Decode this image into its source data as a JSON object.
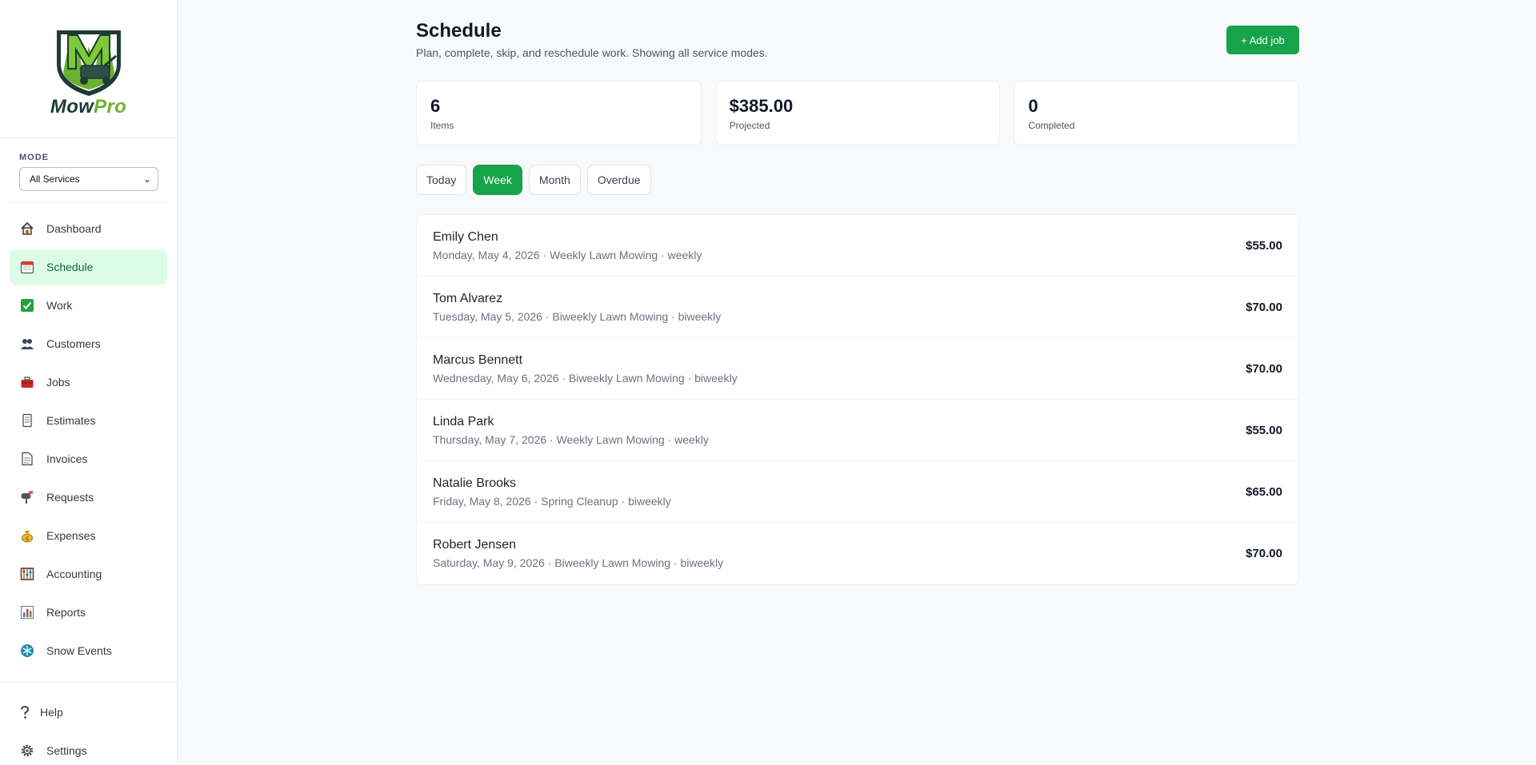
{
  "brand": {
    "name_part1": "Mow",
    "name_part2": "Pro"
  },
  "sidebar": {
    "mode_label": "MODE",
    "mode_value": "All Services",
    "items": [
      {
        "label": "Dashboard",
        "icon": "house-icon"
      },
      {
        "label": "Schedule",
        "icon": "calendar-icon",
        "active": true
      },
      {
        "label": "Work",
        "icon": "check-box-icon"
      },
      {
        "label": "Customers",
        "icon": "people-icon"
      },
      {
        "label": "Jobs",
        "icon": "toolbox-icon"
      },
      {
        "label": "Estimates",
        "icon": "scroll-icon"
      },
      {
        "label": "Invoices",
        "icon": "page-icon"
      },
      {
        "label": "Requests",
        "icon": "mailbox-icon"
      },
      {
        "label": "Expenses",
        "icon": "money-bag-icon"
      },
      {
        "label": "Accounting",
        "icon": "abacus-icon"
      },
      {
        "label": "Reports",
        "icon": "bar-chart-icon"
      },
      {
        "label": "Snow Events",
        "icon": "snowflake-icon"
      }
    ],
    "bottom_items": [
      {
        "label": "Help",
        "icon": "question-icon"
      },
      {
        "label": "Settings",
        "icon": "gear-icon"
      }
    ]
  },
  "header": {
    "title": "Schedule",
    "subtitle": "Plan, complete, skip, and reschedule work. Showing all service modes.",
    "add_label": "+ Add job"
  },
  "stats": [
    {
      "value": "6",
      "label": "Items"
    },
    {
      "value": "$385.00",
      "label": "Projected"
    },
    {
      "value": "0",
      "label": "Completed"
    }
  ],
  "tabs": [
    "Today",
    "Week",
    "Month",
    "Overdue"
  ],
  "active_tab": "Week",
  "schedule": [
    {
      "name": "Emily Chen",
      "meta": "Monday, May 4, 2026 · Weekly Lawn Mowing · weekly",
      "amount": "$55.00"
    },
    {
      "name": "Tom Alvarez",
      "meta": "Tuesday, May 5, 2026 · Biweekly Lawn Mowing · biweekly",
      "amount": "$70.00"
    },
    {
      "name": "Marcus Bennett",
      "meta": "Wednesday, May 6, 2026 · Biweekly Lawn Mowing · biweekly",
      "amount": "$70.00"
    },
    {
      "name": "Linda Park",
      "meta": "Thursday, May 7, 2026 · Weekly Lawn Mowing · weekly",
      "amount": "$55.00"
    },
    {
      "name": "Natalie Brooks",
      "meta": "Friday, May 8, 2026 · Spring Cleanup · biweekly",
      "amount": "$65.00"
    },
    {
      "name": "Robert Jensen",
      "meta": "Saturday, May 9, 2026 · Biweekly Lawn Mowing · biweekly",
      "amount": "$70.00"
    }
  ],
  "colors": {
    "accent": "#16a34a",
    "active_bg": "#dcfce7",
    "logo_dark": "#1e3a34",
    "logo_green": "#6ab22e"
  }
}
